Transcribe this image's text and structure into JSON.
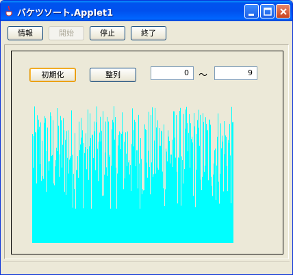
{
  "window": {
    "title": "バケツソート.Applet1",
    "title_icon": "java-cup-icon",
    "controls": [
      "minimize-icon",
      "maximize-icon",
      "close-icon"
    ]
  },
  "toolbar": {
    "info_label": "情報",
    "start_label": "開始",
    "stop_label": "停止",
    "quit_label": "終了"
  },
  "applet": {
    "init_label": "初期化",
    "sort_label": "整列",
    "range_from": "0",
    "range_separator": "～",
    "range_to": "9",
    "bar_color": "#00ffff",
    "bar_count_hint": "many random-height cyan bars (unsorted data)"
  }
}
